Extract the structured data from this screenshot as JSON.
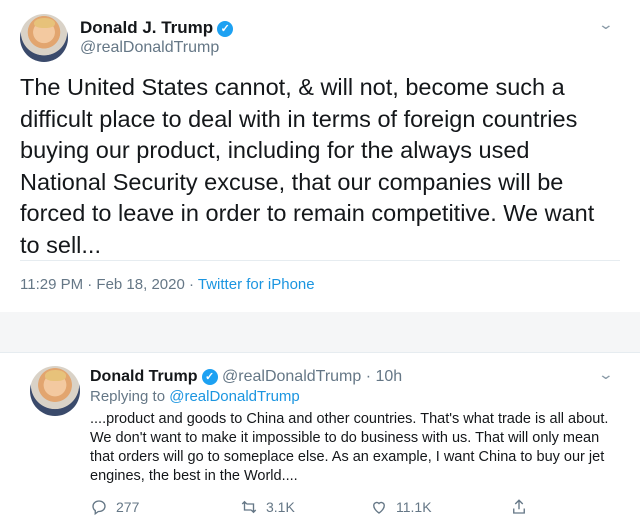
{
  "tweet1": {
    "name": "Donald J. Trump",
    "handle": "@realDonaldTrump",
    "text": "The United States cannot, & will not, become such a difficult place to deal with in terms of foreign countries buying our product, including for the always used National Security excuse, that our companies will be forced to leave in order to remain competitive. We want to sell...",
    "timestamp": "11:29 PM · Feb 18, 2020 · ",
    "source": "Twitter for iPhone"
  },
  "tweet2": {
    "name": "Donald Trump",
    "handle": "@realDonaldTrump · 10h",
    "replying_prefix": "Replying to ",
    "replying_to": "@realDonaldTrump",
    "text": "....product and goods to China and other countries. That's what trade is all about. We don't want to make it impossible to do business with us. That will only mean that orders will go to someplace else. As an example, I want China to buy our jet engines, the best in the World....",
    "replies": "277",
    "retweets": "3.1K",
    "likes": "11.1K"
  },
  "icons": {
    "verified": "verified-badge-icon",
    "menu": "chevron-down-icon",
    "reply": "reply-icon",
    "retweet": "retweet-icon",
    "like": "heart-icon",
    "share": "share-icon"
  },
  "colors": {
    "accent": "#1da1f2",
    "link": "#1b95e0",
    "muted": "#657786"
  }
}
